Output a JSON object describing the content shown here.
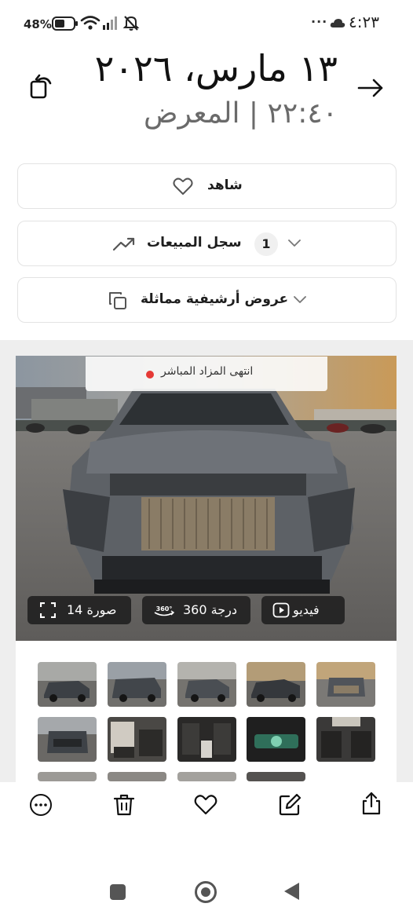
{
  "status_bar": {
    "battery_percent": "48%",
    "time": "٤:٢٣",
    "overflow": "···",
    "icons": [
      "battery-icon",
      "wifi-icon",
      "signal-icon",
      "mute-icon",
      "cloud-icon"
    ]
  },
  "header": {
    "date": "١٣ مارس، ٢٠٢٦",
    "subtitle": "٢٢:٤٠ | المعرض",
    "back_icon": "arrow-right-icon",
    "refresh_icon": "rotate-icon"
  },
  "actions": {
    "watch_label": "شاهد",
    "sales_label": "سجل المبيعات",
    "sales_count": "1",
    "archive_label": "عروض أرشيفية مماثلة"
  },
  "media": {
    "auction_status": "انتهى المزاد المباشر",
    "photos_label": "14 صورة",
    "view360_label": "360 درجة",
    "view360_icon_text": "360°",
    "video_label": "فيديو",
    "photo_count": 14
  },
  "toolbar": {
    "icons": [
      "more-icon",
      "trash-icon",
      "heart-icon",
      "edit-icon",
      "share-icon"
    ]
  },
  "colors": {
    "live_dot": "#e53935",
    "pill_bg": "#1c1c1c",
    "section_bg": "#eeeeee"
  }
}
